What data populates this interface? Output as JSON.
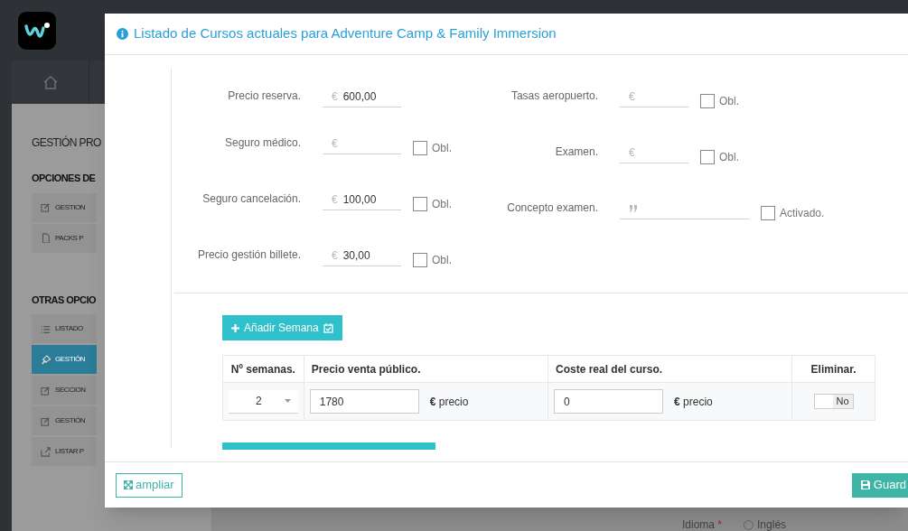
{
  "sidebar": {
    "title": "GESTIÓN PRO",
    "sections": [
      {
        "heading": "OPCIONES DE",
        "items": [
          {
            "kind": "edit",
            "label": "GESTION",
            "selected": false
          },
          {
            "kind": "file",
            "label": "PACKS P",
            "selected": false
          }
        ]
      },
      {
        "heading": "OTRAS OPCIO",
        "items": [
          {
            "kind": "list",
            "label": "LISTADO",
            "selected": false
          },
          {
            "kind": "pin",
            "label": "GESTIÓN",
            "selected": true
          },
          {
            "kind": "edit",
            "label": "SECCION",
            "selected": false
          },
          {
            "kind": "edit",
            "label": "GESTIÓN",
            "selected": false
          },
          {
            "kind": "export",
            "label": "LISTAR P",
            "selected": false
          }
        ]
      }
    ]
  },
  "background_form": {
    "label": "Idioma",
    "mark": "*",
    "option": {
      "label": "Inglés",
      "selected": false
    }
  },
  "modal": {
    "title": "Listado de Cursos actuales para Adventure Camp & Family Immersion",
    "fields_left": [
      {
        "label": "Precio reserva.",
        "kind": "money",
        "prefix": "€",
        "value": "600,00"
      },
      {
        "label": "Seguro médico.",
        "kind": "money",
        "prefix": "€",
        "checkbox": {
          "label": "Obl.",
          "checked": false
        }
      },
      {
        "label": "Seguro cancelación.",
        "kind": "money",
        "prefix": "€",
        "value": "100,00",
        "checkbox": {
          "label": "Obl.",
          "checked": false
        }
      },
      {
        "label": "Precio gestión billete.",
        "kind": "money",
        "prefix": "€",
        "value": "30,00",
        "checkbox": {
          "label": "Obl.",
          "checked": false
        }
      }
    ],
    "fields_right": [
      {
        "label": "Tasas aeropuerto.",
        "kind": "money",
        "prefix": "€",
        "checkbox": {
          "label": "Obl.",
          "checked": false
        }
      },
      {
        "label": "Examen.",
        "kind": "money",
        "prefix": "€",
        "checkbox": {
          "label": "Obl.",
          "checked": false
        }
      },
      {
        "label": "Concepto examen.",
        "kind": "text",
        "checkbox": {
          "label": "Activado.",
          "checked": false
        }
      }
    ],
    "add_button": "Añadir Semana",
    "table": {
      "columns": [
        "Nº semanas.",
        "Precio venta público.",
        "Coste real del curso.",
        "Eliminar."
      ],
      "rows": [
        {
          "weeks": "2",
          "price": "1780",
          "price_unit": "**€** precio",
          "cost": "0",
          "cost_unit": "**€** precio",
          "delete_toggle": {
            "label": "No",
            "on": false
          }
        }
      ]
    },
    "footer": {
      "expand_button": "ampliar",
      "save_button": "Guard"
    }
  }
}
